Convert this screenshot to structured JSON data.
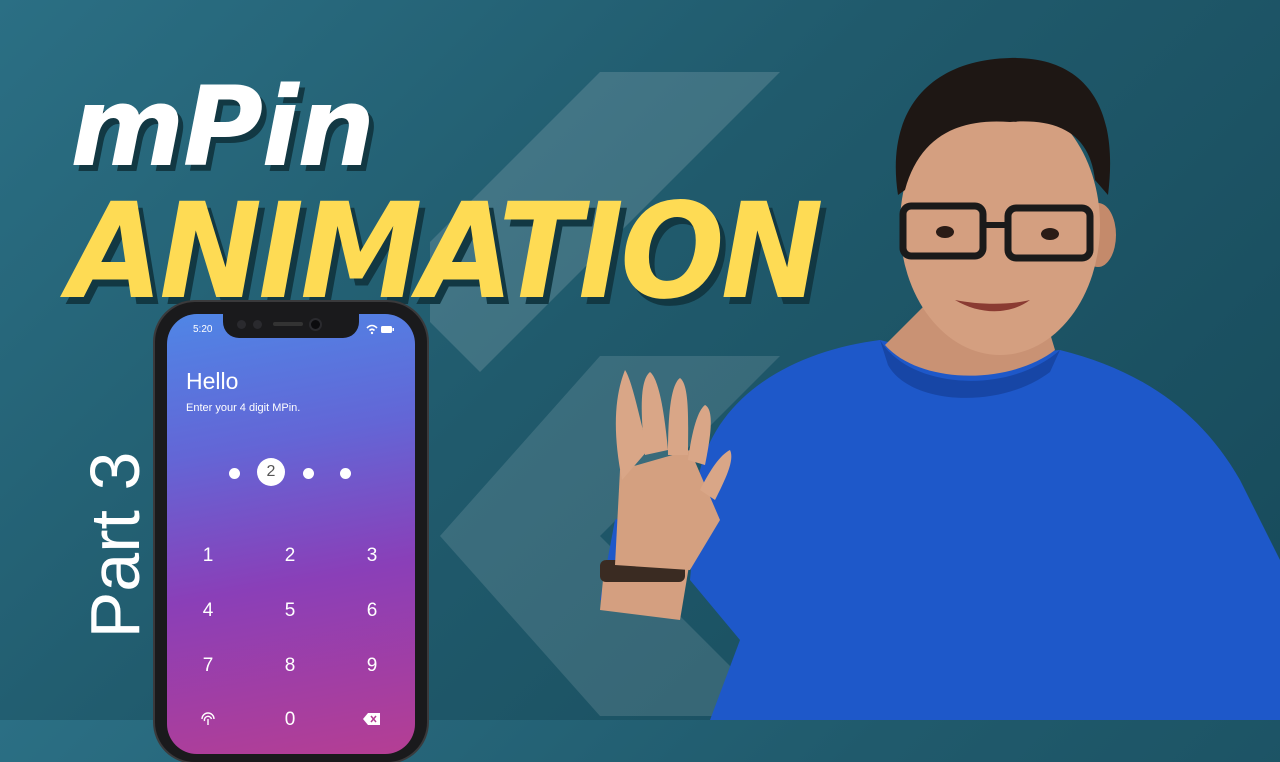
{
  "title": {
    "line1": "mPin",
    "line2": "ANIMATION"
  },
  "part_label": "Part 3",
  "phone": {
    "status_time": "5:20",
    "greeting": "Hello",
    "instruction": "Enter your 4 digit MPin.",
    "active_digit": "2",
    "keypad": [
      "1",
      "2",
      "3",
      "4",
      "5",
      "6",
      "7",
      "8",
      "9",
      "0"
    ]
  },
  "colors": {
    "background": "#205a6c",
    "title_accent": "#fedb54",
    "shirt": "#1e58c9"
  },
  "icons": [
    "flutter-logo",
    "fingerprint-icon",
    "backspace-icon",
    "wifi-icon",
    "battery-icon"
  ]
}
